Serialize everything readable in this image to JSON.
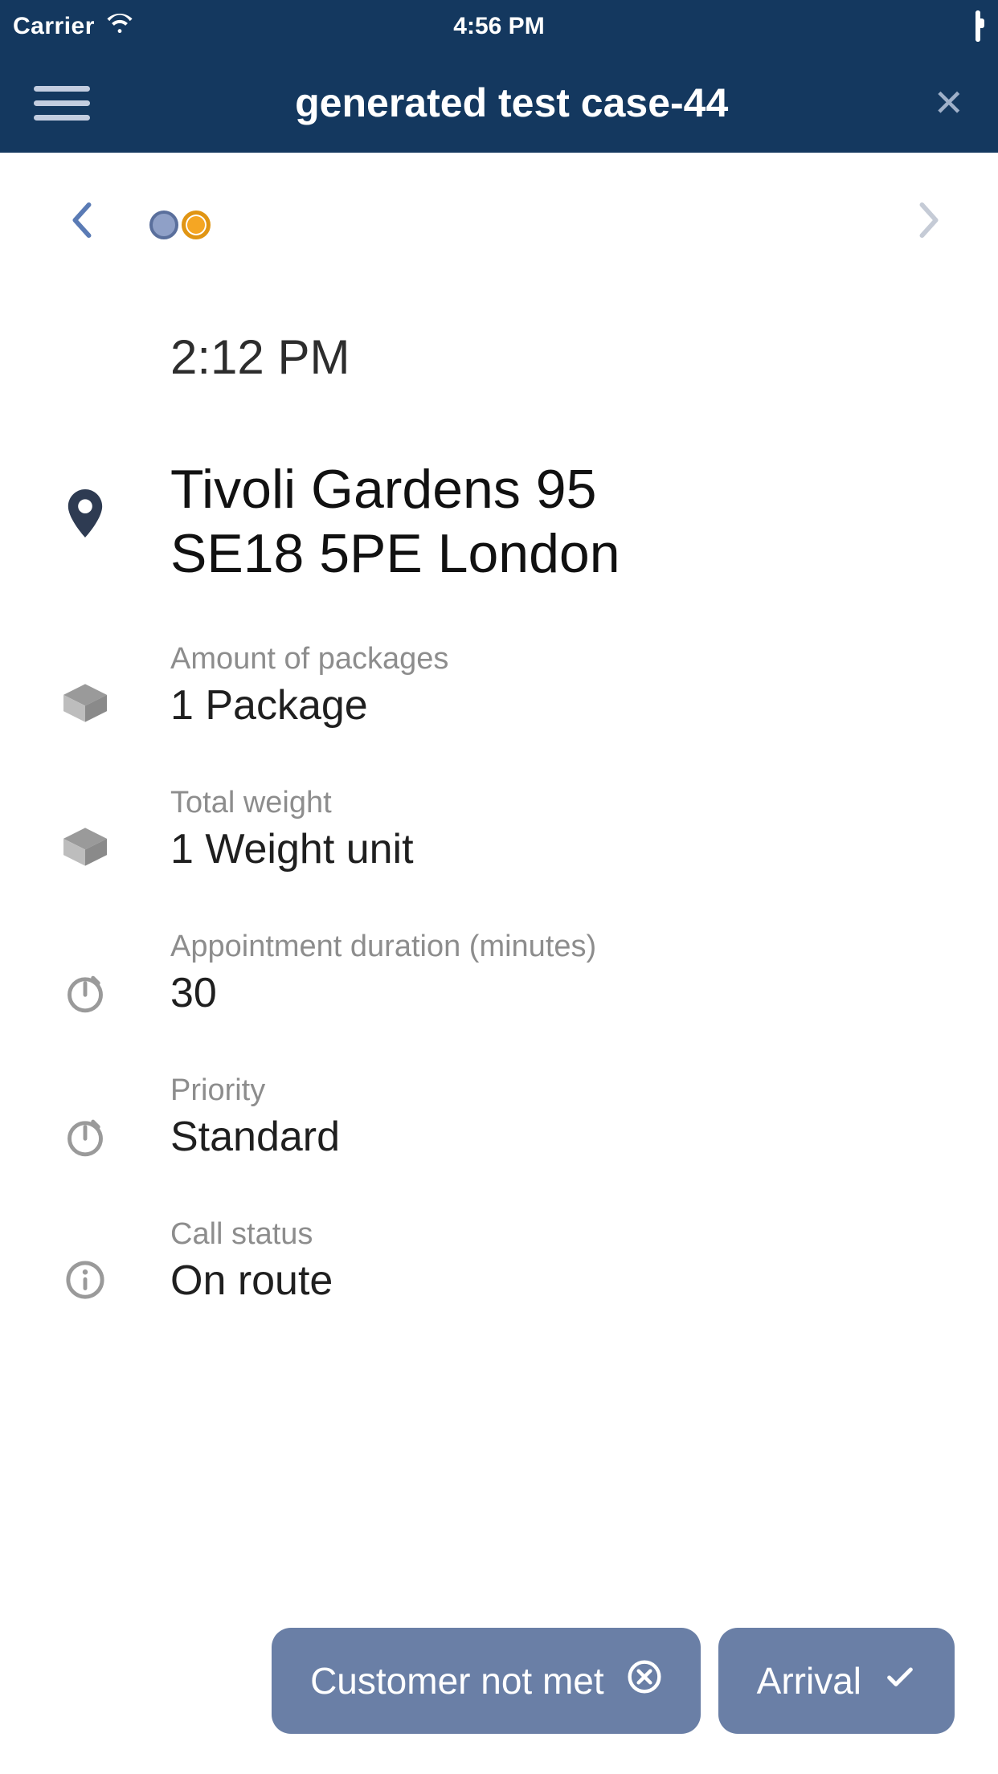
{
  "statusBar": {
    "carrier": "Carrier",
    "time": "4:56 PM"
  },
  "header": {
    "title": "generated test case-44"
  },
  "detail": {
    "time": "2:12 PM",
    "address_line1": "Tivoli Gardens 95",
    "address_line2": "SE18 5PE London",
    "packages": {
      "label": "Amount of packages",
      "value": "1 Package"
    },
    "weight": {
      "label": "Total weight",
      "value": "1 Weight unit"
    },
    "duration": {
      "label": "Appointment duration (minutes)",
      "value": "30"
    },
    "priority": {
      "label": "Priority",
      "value": "Standard"
    },
    "callStatus": {
      "label": "Call status",
      "value": "On route"
    }
  },
  "footer": {
    "notMet": "Customer not met",
    "arrival": "Arrival"
  }
}
